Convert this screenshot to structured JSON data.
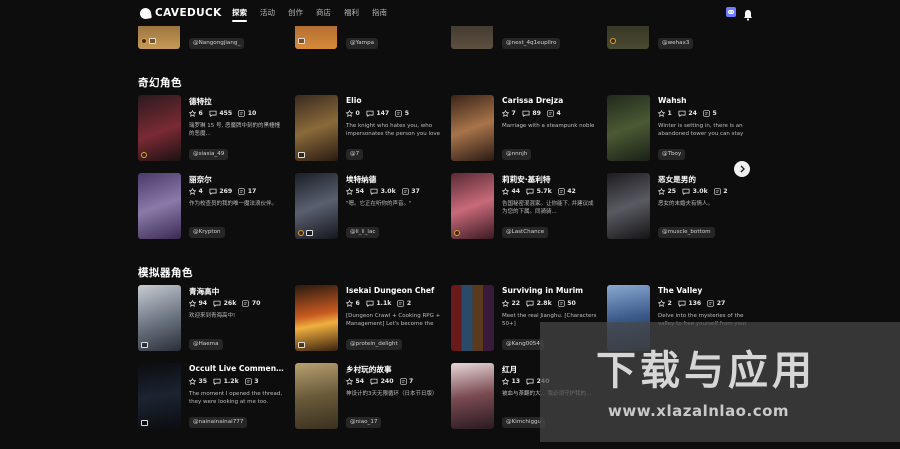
{
  "header": {
    "logo_text": "CAVEDUCK",
    "nav": [
      {
        "label": "探索",
        "active": true
      },
      {
        "label": "活动",
        "active": false
      },
      {
        "label": "创作",
        "active": false
      },
      {
        "label": "商店",
        "active": false
      },
      {
        "label": "福利",
        "active": false
      },
      {
        "label": "指南",
        "active": false
      }
    ],
    "icons": {
      "discord": "discord-icon",
      "bell": "bell-icon"
    }
  },
  "previous_row": {
    "authors": [
      "@Nangongjiang_",
      "@Yampa",
      "@nest_4q1eupllro",
      "@wehax3"
    ]
  },
  "fantasy": {
    "title": "奇幻角色",
    "cards": [
      {
        "name": "德特拉",
        "likes": "6",
        "chats": "455",
        "notes": "10",
        "desc": "瑞罗琳 15 号,\n恶魔牌中刻的的黑幢幢的恶魔...",
        "author": "@siasia_49"
      },
      {
        "name": "Elio",
        "likes": "0",
        "chats": "147",
        "notes": "5",
        "desc": "The knight who hates you, who impersonates the person you love",
        "author": "@7"
      },
      {
        "name": "Carissa Drejza",
        "likes": "7",
        "chats": "89",
        "notes": "4",
        "desc": "Marriage with a steampunk noble",
        "author": "@nnnjh"
      },
      {
        "name": "Wahsh",
        "likes": "1",
        "chats": "24",
        "notes": "5",
        "desc": "Winter is setting in, there is an abandoned tower you can stay at......",
        "author": "@Tboy"
      },
      {
        "name": "丽奈尔",
        "likes": "4",
        "chats": "269",
        "notes": "17",
        "desc": "作为校查员的我的唯一魔法浪伙伴。",
        "author": "@Krypton"
      },
      {
        "name": "埃特纳德",
        "likes": "54",
        "chats": "3.0k",
        "notes": "37",
        "desc": "\"嗯。它正在听你的声音。\"",
        "author": "@li_li_lac"
      },
      {
        "name": "莉莉安·基利特",
        "likes": "44",
        "chats": "5.7k",
        "notes": "42",
        "desc": "告国秘密混混家。让你能下,\n并建议成为您的下属。同骑骑...",
        "author": "@LastChance"
      },
      {
        "name": "恶女是男的",
        "likes": "25",
        "chats": "3.0k",
        "notes": "2",
        "desc": "恶女的末婚夫有情人。",
        "author": "@muscle_bottom"
      }
    ]
  },
  "simulator": {
    "title": "模拟器角色",
    "cards": [
      {
        "name": "青海高中",
        "likes": "94",
        "chats": "26k",
        "notes": "70",
        "desc": "欢迎来到青海高中!",
        "author": "@Haema"
      },
      {
        "name": "Isekai Dungeon Chef",
        "likes": "6",
        "chats": "1.1k",
        "notes": "2",
        "desc": "[Dungeon Crawl + Cooking RPG + Management] Let's become the be...",
        "author": "@protein_delight"
      },
      {
        "name": "Surviving in Murim",
        "likes": "22",
        "chats": "2.8k",
        "notes": "50",
        "desc": "Meet the real Jianghu. [Characters 50+]",
        "author": "@Kang0054"
      },
      {
        "name": "The Valley",
        "likes": "2",
        "chats": "136",
        "notes": "27",
        "desc": "Delve into the mysteries of the valley to free yourself from your captor.",
        "author": ""
      },
      {
        "name": "Occult Live Commentary ...",
        "likes": "35",
        "chats": "1.2k",
        "notes": "3",
        "desc": "The moment I opened the thread, they were looking at me too.",
        "author": "@nainainainai777"
      },
      {
        "name": "乡村玩的故事",
        "likes": "54",
        "chats": "240",
        "notes": "7",
        "desc": "神设计的3天无限循环（日本节日版）",
        "author": "@niao_17"
      },
      {
        "name": "红月",
        "likes": "13",
        "chats": "240",
        "notes": "",
        "desc": "被血与茶翻的大...\n我必须守护我的...",
        "author": "@Kimchiggu"
      }
    ]
  },
  "watermark": {
    "big": "下载与应用",
    "url": "www.xlazalnlao.com"
  }
}
